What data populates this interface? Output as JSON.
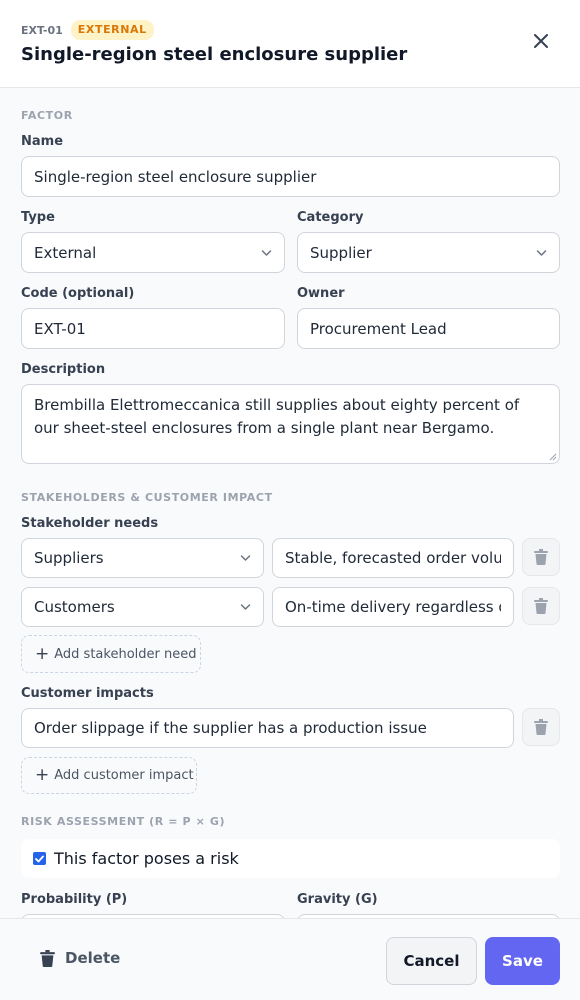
{
  "header": {
    "code": "EXT-01",
    "badge": "EXTERNAL",
    "title": "Single-region steel enclosure supplier",
    "close_icon": "close-icon"
  },
  "factor": {
    "section_title": "FACTOR",
    "name_label": "Name",
    "name_value": "Single-region steel enclosure supplier",
    "type_label": "Type",
    "type_value": "External",
    "category_label": "Category",
    "category_value": "Supplier",
    "code_label": "Code (optional)",
    "code_value": "EXT-01",
    "owner_label": "Owner",
    "owner_value": "Procurement Lead",
    "description_label": "Description",
    "description_value": "Brembilla Elettromeccanica still supplies about eighty percent of our sheet-steel enclosures from a single plant near Bergamo."
  },
  "stakeholders": {
    "section_title": "STAKEHOLDERS & CUSTOMER IMPACT",
    "needs_label": "Stakeholder needs",
    "needs": [
      {
        "stakeholder": "Suppliers",
        "need": "Stable, forecasted order volum"
      },
      {
        "stakeholder": "Customers",
        "need": "On-time delivery regardless of"
      }
    ],
    "add_need_label": "Add stakeholder need",
    "impacts_label": "Customer impacts",
    "impacts": [
      {
        "text": "Order slippage if the supplier has a production issue"
      }
    ],
    "add_impact_label": "Add customer impact"
  },
  "risk": {
    "section_title": "RISK ASSESSMENT (R = P × G)",
    "poses_risk_label": "This factor poses a risk",
    "poses_risk_checked": true,
    "probability_label": "Probability (P)",
    "gravity_label": "Gravity (G)"
  },
  "footer": {
    "delete_label": "Delete",
    "cancel_label": "Cancel",
    "save_label": "Save"
  },
  "colors": {
    "accent": "#6366f1",
    "badge_bg": "#fef3c7",
    "badge_text": "#d97706",
    "checkbox": "#2563eb"
  }
}
